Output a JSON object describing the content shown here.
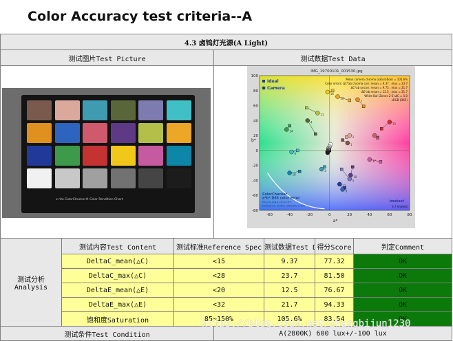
{
  "slide": {
    "title": "Color Accuracy test criteria--A"
  },
  "section_header": "4.3 卤钨灯光源(A Light)",
  "columns": {
    "picture": "测试图片Test Picture",
    "data": "测试数据Test Data"
  },
  "checker": {
    "caption": "x·rite ColorChecker® Color Rendition Chart",
    "patches": [
      "#7a5a4c",
      "#dba99c",
      "#3f9bb0",
      "#59663a",
      "#7e7bb1",
      "#40c0c6",
      "#e0901f",
      "#2d64c0",
      "#cf5a6d",
      "#5e3a86",
      "#b2c04a",
      "#eca726",
      "#213a9a",
      "#3d9a4a",
      "#c43232",
      "#f1c81a",
      "#c65aa0",
      "#0d86a8",
      "#f1f1f1",
      "#c8c8c8",
      "#a0a0a0",
      "#727272",
      "#454545",
      "#1c1c1c"
    ]
  },
  "plot": {
    "file_name": "IMG_19700101_001530.jpg",
    "legend_ideal": "Ideal",
    "legend_camera": "Camera",
    "stats": [
      "Mean camera chroma (saturation) = 105.6%",
      "Color errors: ΔC*ab chroma corr.  mean = 9.37 , max = 23.7",
      "ΔC*ab uncorr.  mean = 9.75 , max = 21.7",
      "ΔE*ab  mean = 12.5 , max = 21.7",
      "White Bal (Zones 2-5) ΔC = 5.0",
      "sRGB (D65)"
    ],
    "footer": [
      "ColorChecker",
      "a*b* D65 color error",
      "05-Jun-2014 16:03:09",
      "Reference: X-Rite (default) (new)"
    ],
    "version": "3.7  Imatest",
    "brand": "imatest",
    "y_ticks": [
      "100",
      "80",
      "60",
      "40",
      "20",
      "0",
      "-20",
      "-40",
      "-60",
      "-80"
    ],
    "x_ticks": [
      "-60",
      "-40",
      "-20",
      "0",
      "20",
      "40",
      "60",
      "80"
    ],
    "xlabel": "a*",
    "ylabel": "b*"
  },
  "chart_data": {
    "type": "scatter",
    "title": "IMG_19700101_001530.jpg",
    "xlabel": "a*",
    "ylabel": "b*",
    "xlim": [
      -70,
      80
    ],
    "ylim": [
      -80,
      100
    ],
    "series": [
      {
        "name": "Ideal",
        "points": [
          [
            13,
            14
          ],
          [
            17,
            18
          ],
          [
            -5,
            -22
          ],
          [
            -14,
            22
          ],
          [
            12,
            -25
          ],
          [
            -32,
            0
          ],
          [
            34,
            59
          ],
          [
            10,
            -45
          ],
          [
            48,
            17
          ],
          [
            23,
            -22
          ],
          [
            -23,
            57
          ],
          [
            20,
            67
          ],
          [
            15,
            -50
          ],
          [
            -40,
            33
          ],
          [
            52,
            29
          ],
          [
            3,
            80
          ],
          [
            51,
            -15
          ],
          [
            -30,
            -28
          ],
          [
            0,
            0
          ],
          [
            0,
            0
          ],
          [
            0,
            0
          ],
          [
            0,
            0
          ],
          [
            0,
            0
          ],
          [
            0,
            0
          ]
        ]
      },
      {
        "name": "Camera",
        "points": [
          [
            18,
            10
          ],
          [
            20,
            20
          ],
          [
            -8,
            -25
          ],
          [
            -22,
            40
          ],
          [
            20,
            -38
          ],
          [
            -38,
            -2
          ],
          [
            28,
            68
          ],
          [
            13,
            -52
          ],
          [
            45,
            20
          ],
          [
            21,
            -33
          ],
          [
            -12,
            50
          ],
          [
            8,
            72
          ],
          [
            10,
            -45
          ],
          [
            -43,
            28
          ],
          [
            60,
            38
          ],
          [
            -2,
            78
          ],
          [
            40,
            -12
          ],
          [
            -40,
            -30
          ],
          [
            1,
            8
          ],
          [
            0,
            5
          ],
          [
            -1,
            3
          ],
          [
            -1,
            1
          ],
          [
            -2,
            -1
          ],
          [
            -2,
            -3
          ]
        ]
      }
    ],
    "stats": {
      "mean_chroma_pct": 105.6,
      "dC_corr_mean": 9.37,
      "dC_corr_max": 23.7,
      "dC_uncorr_mean": 9.75,
      "dC_uncorr_max": 21.7,
      "dE_mean": 12.5,
      "dE_max": 21.7,
      "white_bal_dC": 5.0
    }
  },
  "table": {
    "header": {
      "item": "测试内容Test Content",
      "spec": "测试标准Reference Spec",
      "data": "测试数据Test Data",
      "score": "得分Score",
      "judge": "判定Comment"
    },
    "group_label": "测试分析",
    "group_label_en": "Analysis",
    "rows": [
      {
        "item": "DeltaC_mean(△C)",
        "spec": "<15",
        "data": "9.37",
        "score": "77.32",
        "judge": "OK"
      },
      {
        "item": "DeltaC_max(△C)",
        "spec": "<28",
        "data": "23.7",
        "score": "81.50",
        "judge": "OK"
      },
      {
        "item": "DeltaE_mean(△E)",
        "spec": "<20",
        "data": "12.5",
        "score": "76.67",
        "judge": "OK"
      },
      {
        "item": "DeltaE_max(△E)",
        "spec": "<32",
        "data": "21.7",
        "score": "94.33",
        "judge": "OK"
      },
      {
        "item": "饱和度Saturation",
        "spec": "85~150%",
        "data": "105.6%",
        "score": "83.54",
        "judge": "OK"
      }
    ],
    "condition_label": "测试条件Test Condition",
    "condition_value": "A(2800K) 600 lux+/-100 lux"
  },
  "watermark": "https://blog.csdn.net/zhangbijun1230",
  "colors": {
    "ok_green": "#0b7a0b",
    "spec_yellow": "#ffff99",
    "header_gray": "#e8e8e8"
  }
}
